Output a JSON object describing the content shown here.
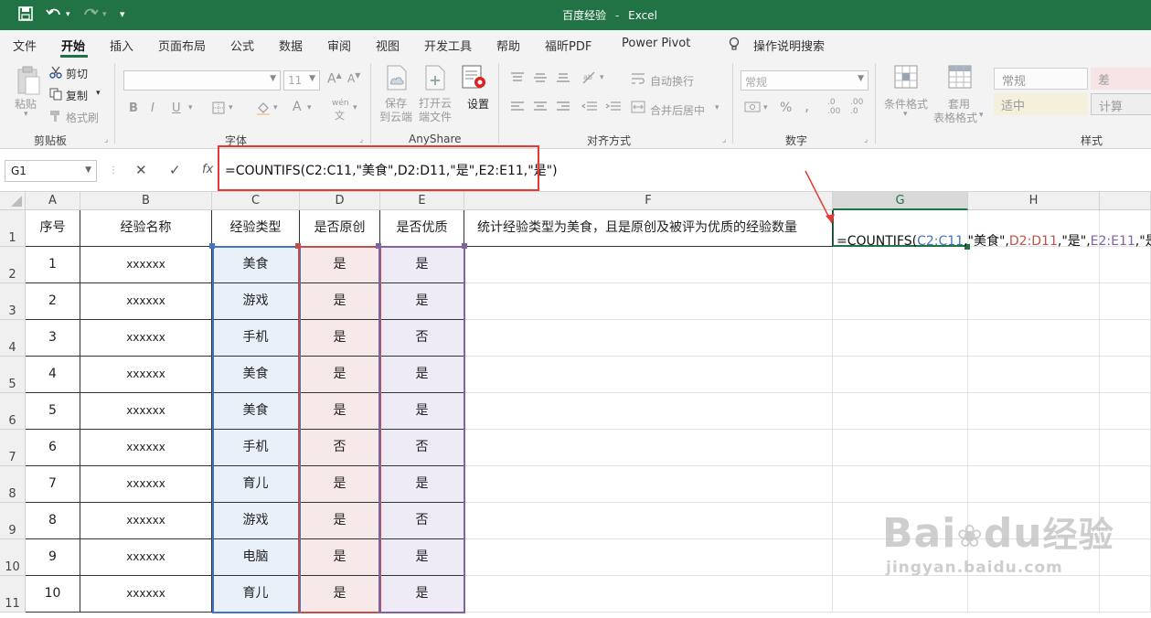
{
  "app": {
    "title": "百度经验",
    "separator": "-",
    "app_name": "Excel"
  },
  "tabs": [
    {
      "label": "文件"
    },
    {
      "label": "开始",
      "active": true
    },
    {
      "label": "插入"
    },
    {
      "label": "页面布局"
    },
    {
      "label": "公式"
    },
    {
      "label": "数据"
    },
    {
      "label": "审阅"
    },
    {
      "label": "视图"
    },
    {
      "label": "开发工具"
    },
    {
      "label": "帮助"
    },
    {
      "label": "福昕PDF"
    },
    {
      "label": "Power Pivot"
    },
    {
      "label": "操作说明搜索"
    }
  ],
  "ribbon": {
    "clipboard": {
      "paste": "粘贴",
      "cut": "剪切",
      "copy": "复制",
      "format_painter": "格式刷",
      "group": "剪贴板"
    },
    "font": {
      "size": "11",
      "group": "字体",
      "bold": "B",
      "italic": "I",
      "underline": "U",
      "font_color": "A",
      "phonetic": "wén"
    },
    "anyshare": {
      "save_cloud": [
        "保存",
        "到云端"
      ],
      "open_cloud": [
        "打开云",
        "端文件"
      ],
      "settings": "设置",
      "group": "AnyShare"
    },
    "alignment": {
      "wrap": "自动换行",
      "merge": "合并后居中",
      "group": "对齐方式"
    },
    "number": {
      "format": "常规",
      "group": "数字",
      "percent": "%",
      "comma": ",",
      "inc_decimal": ".0\n.00",
      "dec_decimal": ".00\n.0"
    },
    "styles": {
      "conditional": "条件格式",
      "table_format": [
        "套用",
        "表格格式"
      ],
      "normal": "常规",
      "bad": "差",
      "neutral": "适中",
      "calc": "计算",
      "group": "样式"
    }
  },
  "formula_bar": {
    "name_box": "G1",
    "cancel": "✕",
    "enter": "✓",
    "fx": "fx",
    "formula": "=COUNTIFS(C2:C11,\"美食\",D2:D11,\"是\",E2:E11,\"是\")"
  },
  "columns": [
    "A",
    "B",
    "C",
    "D",
    "E",
    "F",
    "G",
    "H"
  ],
  "rows": [
    "1",
    "2",
    "3",
    "4",
    "5",
    "6",
    "7",
    "8",
    "9",
    "10",
    "11"
  ],
  "headers": [
    "序号",
    "经验名称",
    "经验类型",
    "是否原创",
    "是否优质",
    "统计经验类型为美食，且是原创及被评为优质的经验数量"
  ],
  "table": [
    [
      "1",
      "xxxxxx",
      "美食",
      "是",
      "是"
    ],
    [
      "2",
      "xxxxxx",
      "游戏",
      "是",
      "是"
    ],
    [
      "3",
      "xxxxxx",
      "手机",
      "是",
      "否"
    ],
    [
      "4",
      "xxxxxx",
      "美食",
      "是",
      "是"
    ],
    [
      "5",
      "xxxxxx",
      "美食",
      "是",
      "是"
    ],
    [
      "6",
      "xxxxxx",
      "手机",
      "否",
      "否"
    ],
    [
      "7",
      "xxxxxx",
      "育儿",
      "是",
      "是"
    ],
    [
      "8",
      "xxxxxx",
      "游戏",
      "是",
      "否"
    ],
    [
      "9",
      "xxxxxx",
      "电脑",
      "是",
      "是"
    ],
    [
      "10",
      "xxxxxx",
      "育儿",
      "是",
      "是"
    ]
  ],
  "g1_formula_parts": {
    "p1": "=COUNTIFS(",
    "r1": "C2:C11",
    "p2": ",\"美食\",",
    "r2": "D2:D11",
    "p3": ",\"是\",",
    "r3": "E2:E11",
    "p4": ",\"是\")"
  },
  "colors": {
    "excel_green": "#217346",
    "range_c": "#4472c4",
    "range_d": "#c0504d",
    "range_e": "#8064a2",
    "highlight_box": "#e53935"
  },
  "watermark": {
    "brand": "Bai",
    "brand2": "du",
    "brand3": "经验",
    "url": "jingyan.baidu.com"
  }
}
